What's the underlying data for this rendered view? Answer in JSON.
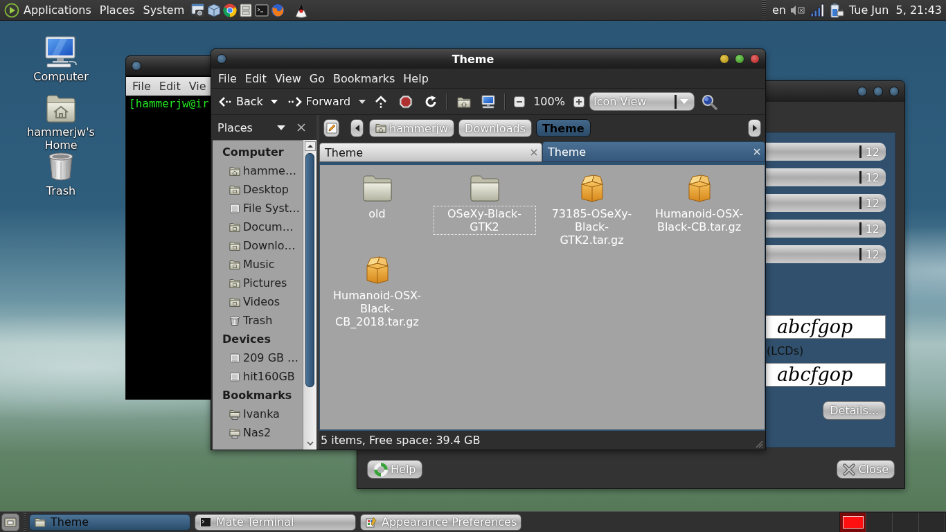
{
  "top_panel": {
    "menus": [
      "Applications",
      "Places",
      "System"
    ],
    "keyboard_layout": "en",
    "clock": "Tue Jun  5, 21:43"
  },
  "desktop_icons": [
    {
      "label": "Computer",
      "kind": "computer"
    },
    {
      "label": "hammerjw's Home",
      "kind": "home"
    },
    {
      "label": "Trash",
      "kind": "trash"
    }
  ],
  "terminal_window": {
    "menus": [
      "File",
      "Edit",
      "Vie"
    ],
    "prompt": "[hammerjw@ir"
  },
  "appearance_window": {
    "font_buttons": [
      {
        "size": "12"
      },
      {
        "size": "12"
      },
      {
        "size": "12"
      },
      {
        "size": "12"
      },
      {
        "size": "12"
      }
    ],
    "previews": [
      {
        "sample": "abcfgop"
      },
      {
        "sample": "abcfgop"
      }
    ],
    "lcd_label": "(LCDs)",
    "details_button": "Details...",
    "help_button": "Help",
    "close_button": "Close"
  },
  "file_manager": {
    "title": "Theme",
    "menus": [
      "File",
      "Edit",
      "View",
      "Go",
      "Bookmarks",
      "Help"
    ],
    "toolbar": {
      "back": "Back",
      "forward": "Forward",
      "zoom_level": "100%",
      "view_mode": "Icon View"
    },
    "side_pane": {
      "title": "Places",
      "sections": [
        {
          "heading": "Computer",
          "items": [
            {
              "label": "hamme…",
              "kind": "home"
            },
            {
              "label": "Desktop",
              "kind": "folder"
            },
            {
              "label": "File Syst…",
              "kind": "drive"
            },
            {
              "label": "Docum…",
              "kind": "folder"
            },
            {
              "label": "Downlo…",
              "kind": "folder"
            },
            {
              "label": "Music",
              "kind": "folder"
            },
            {
              "label": "Pictures",
              "kind": "folder"
            },
            {
              "label": "Videos",
              "kind": "folder"
            },
            {
              "label": "Trash",
              "kind": "trash"
            }
          ]
        },
        {
          "heading": "Devices",
          "items": [
            {
              "label": "209 GB …",
              "kind": "drive"
            },
            {
              "label": "hit160GB",
              "kind": "drive"
            }
          ]
        },
        {
          "heading": "Bookmarks",
          "items": [
            {
              "label": "Ivanka",
              "kind": "share"
            },
            {
              "label": "Nas2",
              "kind": "share"
            }
          ]
        }
      ]
    },
    "path": [
      {
        "label": "hammerjw",
        "selected": false
      },
      {
        "label": "Downloads",
        "selected": false
      },
      {
        "label": "Theme",
        "selected": true
      }
    ],
    "tabs": [
      {
        "label": "Theme",
        "selected": false
      },
      {
        "label": "Theme",
        "selected": true
      }
    ],
    "files": [
      {
        "name": "old",
        "kind": "folder",
        "focused": false
      },
      {
        "name": "OSeXy-Black-GTK2",
        "kind": "folder",
        "focused": true
      },
      {
        "name": "73185-OSeXy-Black-GTK2.tar.gz",
        "kind": "archive",
        "focused": false
      },
      {
        "name": "Humanoid-OSX-Black-CB.tar.gz",
        "kind": "archive",
        "focused": false
      },
      {
        "name": "Humanoid-OSX-Black-CB_2018.tar.gz",
        "kind": "archive",
        "focused": false
      }
    ],
    "status": "5 items, Free space: 39.4 GB"
  },
  "taskbar": {
    "tasks": [
      {
        "label": "Theme",
        "selected": true
      },
      {
        "label": "Mate Terminal",
        "selected": false
      },
      {
        "label": "Appearance Preferences",
        "selected": false
      }
    ],
    "workspaces": [
      {
        "selected": true
      },
      {
        "selected": false
      },
      {
        "selected": false
      },
      {
        "selected": false
      }
    ]
  }
}
